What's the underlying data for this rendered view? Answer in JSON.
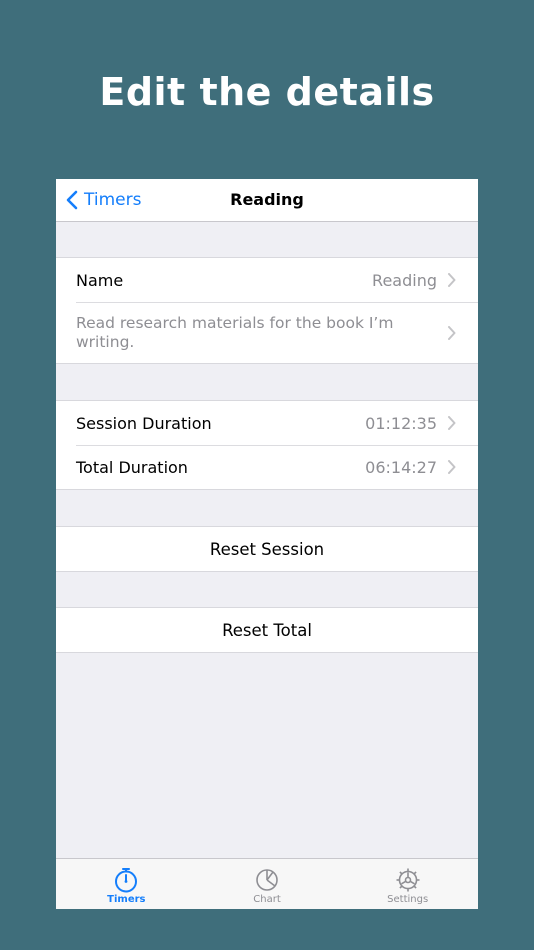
{
  "promo": {
    "title": "Edit the details"
  },
  "navbar": {
    "back_label": "Timers",
    "title": "Reading"
  },
  "details": {
    "name_label": "Name",
    "name_value": "Reading",
    "description": "Read research materials for the book I’m writing."
  },
  "durations": {
    "session_label": "Session Duration",
    "session_value": "01:12:35",
    "total_label": "Total Duration",
    "total_value": "06:14:27"
  },
  "actions": {
    "reset_session": "Reset Session",
    "reset_total": "Reset Total"
  },
  "tabbar": {
    "tabs": [
      {
        "label": "Timers",
        "icon": "stopwatch-icon",
        "active": true
      },
      {
        "label": "Chart",
        "icon": "pie-chart-icon",
        "active": false
      },
      {
        "label": "Settings",
        "icon": "gear-icon",
        "active": false
      }
    ]
  },
  "colors": {
    "background": "#3f6e7b",
    "accent": "#147efb",
    "secondary_text": "#8e8e93"
  }
}
